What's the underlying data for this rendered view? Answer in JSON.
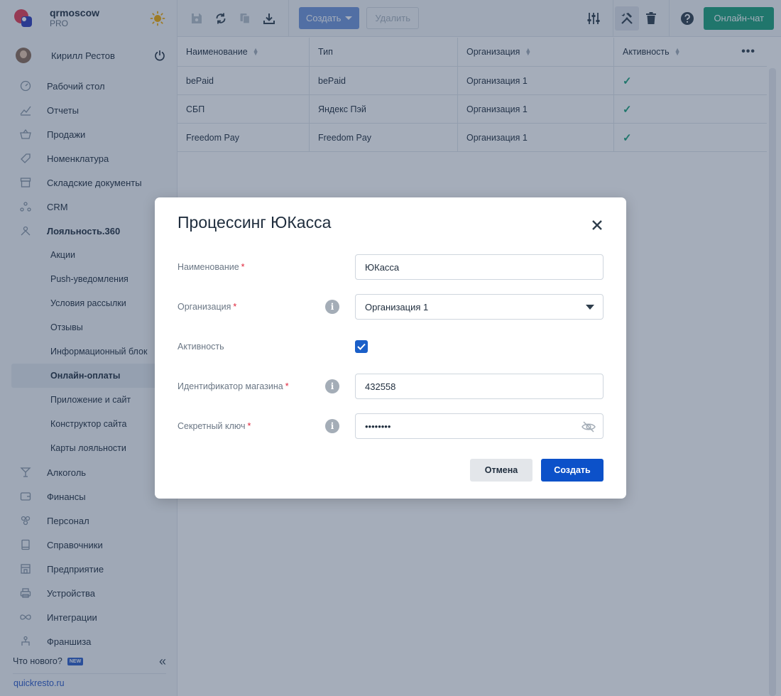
{
  "brand": {
    "name": "qrmoscow",
    "plan": "PRO"
  },
  "user": {
    "name": "Кирилл Рестов"
  },
  "nav": {
    "items": [
      {
        "label": "Рабочий стол",
        "icon": "dashboard-icon"
      },
      {
        "label": "Отчеты",
        "icon": "chart-icon"
      },
      {
        "label": "Продажи",
        "icon": "basket-icon"
      },
      {
        "label": "Номенклатура",
        "icon": "tag-icon"
      },
      {
        "label": "Складские документы",
        "icon": "archive-icon"
      },
      {
        "label": "CRM",
        "icon": "crm-icon"
      },
      {
        "label": "Лояльность.360",
        "icon": "loyalty-icon"
      }
    ],
    "sub_items": [
      {
        "label": "Акции"
      },
      {
        "label": "Push-уведомления"
      },
      {
        "label": "Условия рассылки"
      },
      {
        "label": "Отзывы"
      },
      {
        "label": "Информационный блок"
      },
      {
        "label": "Онлайн-оплаты"
      },
      {
        "label": "Приложение и сайт"
      },
      {
        "label": "Конструктор сайта"
      },
      {
        "label": "Карты лояльности"
      }
    ],
    "bottom_items": [
      {
        "label": "Алкоголь",
        "icon": "cocktail-icon"
      },
      {
        "label": "Финансы",
        "icon": "wallet-icon"
      },
      {
        "label": "Персонал",
        "icon": "people-icon"
      },
      {
        "label": "Справочники",
        "icon": "book-icon"
      },
      {
        "label": "Предприятие",
        "icon": "store-icon"
      },
      {
        "label": "Устройства",
        "icon": "printer-icon"
      },
      {
        "label": "Интеграции",
        "icon": "infinity-icon"
      },
      {
        "label": "Франшиза",
        "icon": "franchise-icon"
      }
    ]
  },
  "footer": {
    "whats_new": "Что нового?",
    "badge": "NEW",
    "site": "quickresto.ru"
  },
  "toolbar": {
    "create_label": "Создать",
    "delete_label": "Удалить",
    "chat_label": "Онлайн-чат"
  },
  "table": {
    "headers": {
      "name": "Наименование",
      "type": "Тип",
      "org": "Организация",
      "active": "Активность"
    },
    "rows": [
      {
        "name": "bePaid",
        "type": "bePaid",
        "org": "Организация 1",
        "active": "✓"
      },
      {
        "name": "СБП",
        "type": "Яндекс Пэй",
        "org": "Организация 1",
        "active": "✓"
      },
      {
        "name": "Freedom Pay",
        "type": "Freedom Pay",
        "org": "Организация 1",
        "active": "✓"
      }
    ]
  },
  "modal": {
    "title": "Процессинг ЮКасса",
    "name_label": "Наименование",
    "name_value": "ЮКасса",
    "org_label": "Организация",
    "org_value": "Организация 1",
    "active_label": "Активность",
    "active_checked": true,
    "shop_label": "Идентификатор магазина",
    "shop_value": "432558",
    "secret_label": "Секретный ключ",
    "secret_value": "••••••••",
    "required_mark": "*",
    "cancel_label": "Отмена",
    "submit_label": "Создать"
  },
  "colors": {
    "primary": "#0c51c9",
    "chat": "#1aa179",
    "required": "#e0243a",
    "check": "#1aa179"
  }
}
